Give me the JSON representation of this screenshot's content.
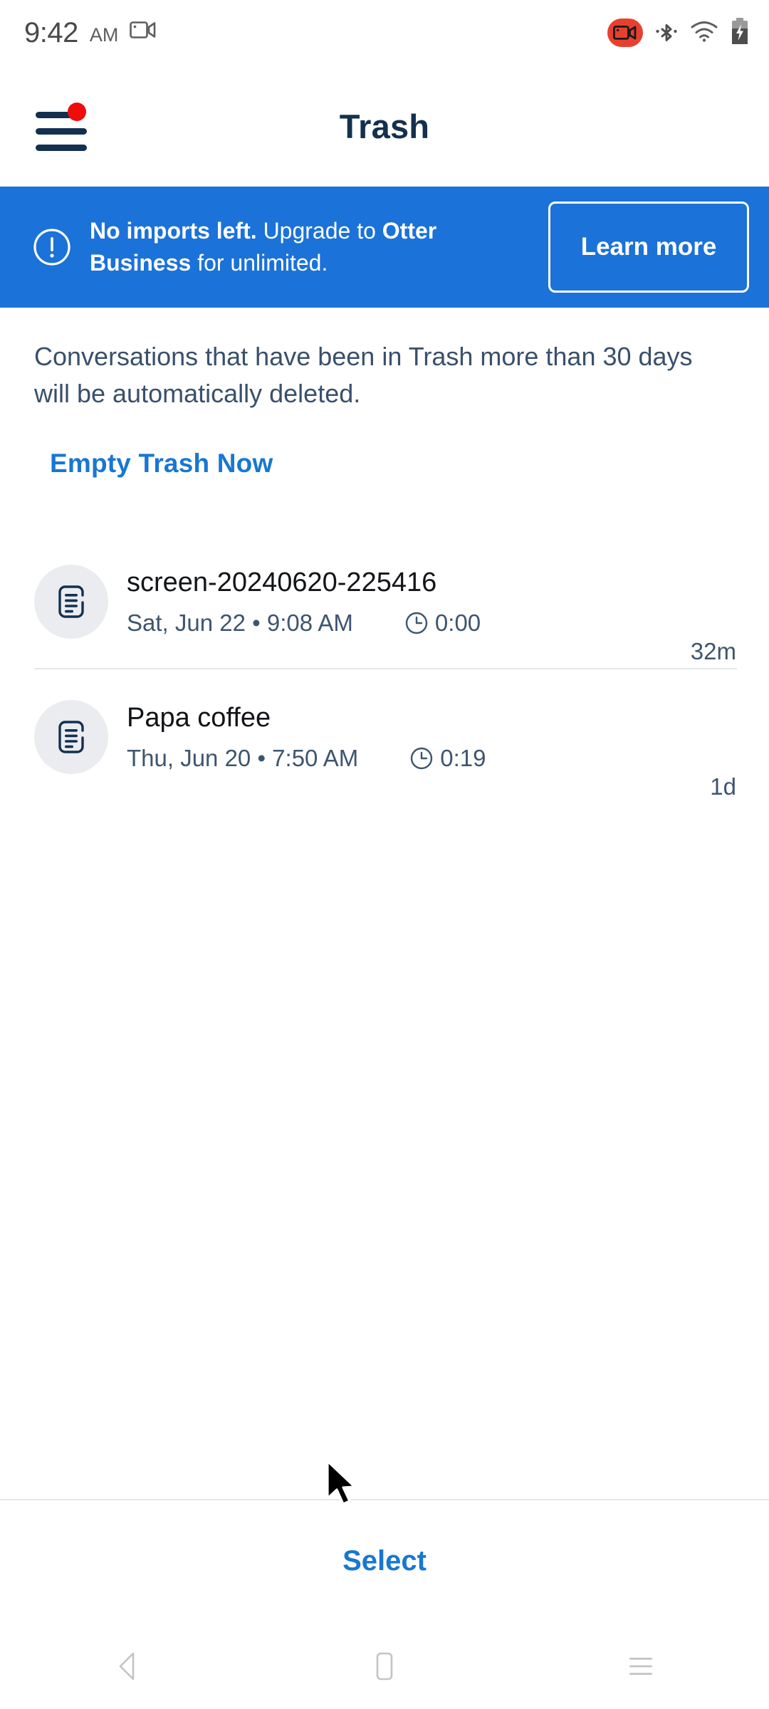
{
  "status_bar": {
    "time": "9:42",
    "ampm": "AM",
    "icons": [
      "screen-record-icon",
      "recording-badge-icon",
      "bluetooth-icon",
      "wifi-icon",
      "battery-charging-icon"
    ]
  },
  "app_bar": {
    "title": "Trash",
    "menu_icon": "hamburger-menu-icon",
    "badge_visible": true
  },
  "banner": {
    "icon": "alert-circle-icon",
    "text_part1": "No imports left.",
    "text_part2": " Upgrade to ",
    "text_part3": "Otter Business",
    "text_part4": " for unlimited.",
    "button_label": "Learn more",
    "background_color": "#1b72d8"
  },
  "description": {
    "text": "Conversations that have been in Trash more than 30 days will be automatically deleted.",
    "empty_trash_label": "Empty Trash Now",
    "link_color": "#1877d2"
  },
  "conversations": [
    {
      "title": "screen-20240620-225416",
      "date": "Sat, Jun 22 • 9:08 AM",
      "duration": "0:00",
      "age": "32m",
      "icon": "document-lines-icon"
    },
    {
      "title": "Papa coffee",
      "date": "Thu, Jun 20 • 7:50 AM",
      "duration": "0:19",
      "age": "1d",
      "icon": "document-lines-icon"
    }
  ],
  "bottom_bar": {
    "select_label": "Select"
  },
  "nav_bar": {
    "back_icon": "back-triangle-icon",
    "home_icon": "home-square-icon",
    "recents_icon": "recents-lines-icon"
  }
}
